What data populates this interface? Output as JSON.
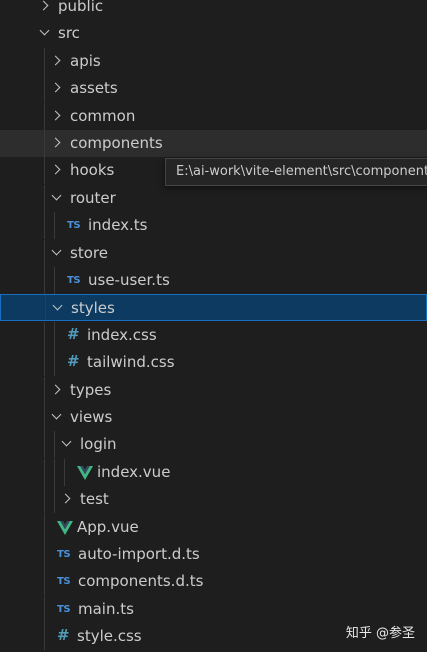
{
  "explorer": {
    "rows": [
      {
        "label": "public",
        "kind": "folder",
        "state": "collapsed",
        "depth": 1
      },
      {
        "label": "src",
        "kind": "folder",
        "state": "expanded",
        "depth": 1
      },
      {
        "label": "apis",
        "kind": "folder",
        "state": "collapsed",
        "depth": 2
      },
      {
        "label": "assets",
        "kind": "folder",
        "state": "collapsed",
        "depth": 2
      },
      {
        "label": "common",
        "kind": "folder",
        "state": "collapsed",
        "depth": 2
      },
      {
        "label": "components",
        "kind": "folder",
        "state": "collapsed",
        "depth": 2,
        "hover": true
      },
      {
        "label": "hooks",
        "kind": "folder",
        "state": "collapsed",
        "depth": 2
      },
      {
        "label": "router",
        "kind": "folder",
        "state": "expanded",
        "depth": 2
      },
      {
        "label": "index.ts",
        "kind": "file",
        "icon": "ts-icon",
        "icon_text": "TS",
        "depth": 3
      },
      {
        "label": "store",
        "kind": "folder",
        "state": "expanded",
        "depth": 2
      },
      {
        "label": "use-user.ts",
        "kind": "file",
        "icon": "ts-icon",
        "icon_text": "TS",
        "depth": 3
      },
      {
        "label": "styles",
        "kind": "folder",
        "state": "expanded",
        "depth": 2,
        "selected": true
      },
      {
        "label": "index.css",
        "kind": "file",
        "icon": "css-icon",
        "icon_text": "#",
        "depth": 3
      },
      {
        "label": "tailwind.css",
        "kind": "file",
        "icon": "css-icon",
        "icon_text": "#",
        "depth": 3
      },
      {
        "label": "types",
        "kind": "folder",
        "state": "collapsed",
        "depth": 2
      },
      {
        "label": "views",
        "kind": "folder",
        "state": "expanded",
        "depth": 2
      },
      {
        "label": "login",
        "kind": "folder",
        "state": "expanded",
        "depth": 3
      },
      {
        "label": "index.vue",
        "kind": "file",
        "icon": "vue-icon",
        "icon_text": "",
        "depth": 4
      },
      {
        "label": "test",
        "kind": "folder",
        "state": "collapsed",
        "depth": 3
      },
      {
        "label": "App.vue",
        "kind": "file",
        "icon": "vue-icon",
        "icon_text": "",
        "depth": 2
      },
      {
        "label": "auto-import.d.ts",
        "kind": "file",
        "icon": "ts-icon",
        "icon_text": "TS",
        "depth": 2
      },
      {
        "label": "components.d.ts",
        "kind": "file",
        "icon": "ts-icon",
        "icon_text": "TS",
        "depth": 2
      },
      {
        "label": "main.ts",
        "kind": "file",
        "icon": "ts-icon",
        "icon_text": "TS",
        "depth": 2
      },
      {
        "label": "style.css",
        "kind": "file",
        "icon": "css-icon",
        "icon_text": "#",
        "depth": 2
      }
    ]
  },
  "tooltip": {
    "text": "E:\\ai-work\\vite-element\\src\\components"
  },
  "watermark": {
    "text": "知乎 @参圣"
  },
  "colors": {
    "selected_bg": "#0d3a60",
    "selected_border": "#1a6ec0",
    "ts": "#4a90d9",
    "css": "#519aba",
    "vue": "#41b883"
  }
}
